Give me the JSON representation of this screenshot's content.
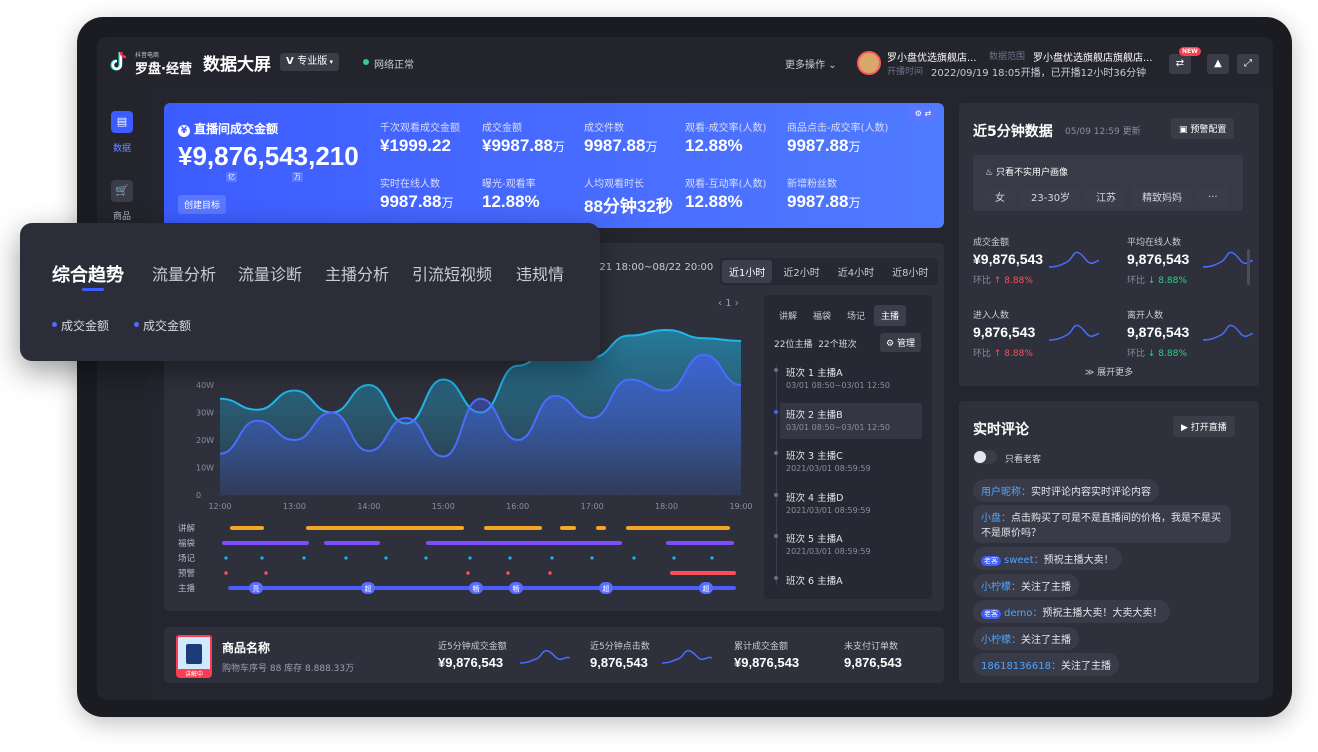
{
  "brand": {
    "small": "抖音电商",
    "name": "罗盘·经营"
  },
  "header": {
    "title": "数据大屏",
    "edition": "专业版",
    "network": "网络正常",
    "more": "更多操作",
    "shop_name": "罗小盘优选旗舰店...",
    "range_label": "数据范围",
    "range_value": "罗小盘优选旗舰店旗舰店...",
    "time_label": "开播时间",
    "time_value": "2022/09/19 18:05开播，已开播12小时36分钟",
    "new_badge": "NEW"
  },
  "sidebar": {
    "items": [
      {
        "label": "数据",
        "icon": "data-icon",
        "active": true
      },
      {
        "label": "商品",
        "icon": "cart-icon",
        "active": false
      }
    ]
  },
  "gmv": {
    "title": "直播间成交金额",
    "value": "¥9,876,543,210",
    "unit1": "亿",
    "unit2": "万",
    "create_goal": "创建目标"
  },
  "metrics": [
    {
      "label": "千次观看成交金额",
      "value": "¥1999.22",
      "unit": ""
    },
    {
      "label": "成交金额",
      "value": "¥9987.88",
      "unit": "万"
    },
    {
      "label": "成交件数",
      "value": "9987.88",
      "unit": "万"
    },
    {
      "label": "观看-成交率(人数)",
      "value": "12.88%",
      "unit": ""
    },
    {
      "label": "商品点击-成交率(人数)",
      "value": "9987.88",
      "unit": "万"
    },
    {
      "label": "实时在线人数",
      "value": "9987.88",
      "unit": "万"
    },
    {
      "label": "曝光-观看率",
      "value": "12.88%",
      "unit": ""
    },
    {
      "label": "人均观看时长",
      "value": "88分钟32秒",
      "unit": ""
    },
    {
      "label": "观看-互动率(人数)",
      "value": "12.88%",
      "unit": ""
    },
    {
      "label": "新增粉丝数",
      "value": "9987.88",
      "unit": "万"
    }
  ],
  "trend": {
    "range": "/21 18:00~08/22 20:00",
    "time_tabs": [
      "近1小时",
      "近2小时",
      "近4小时",
      "近8小时"
    ],
    "pager": "1",
    "y_ticks": [
      "40W",
      "30W",
      "20W",
      "10W",
      "0"
    ],
    "x_ticks": [
      "12:00",
      "13:00",
      "14:00",
      "15:00",
      "16:00",
      "17:00",
      "18:00",
      "19:00"
    ],
    "rows": [
      "讲解",
      "福袋",
      "场记",
      "预警",
      "主播"
    ],
    "anchor_marks": [
      "亮",
      "超",
      "畅",
      "畅",
      "超",
      "超"
    ]
  },
  "chart_data": {
    "type": "area",
    "x": [
      "12:00",
      "12:30",
      "13:00",
      "13:30",
      "14:00",
      "14:30",
      "15:00",
      "15:30",
      "16:00",
      "16:30",
      "17:00",
      "17:30",
      "18:00",
      "18:30",
      "19:00"
    ],
    "series": [
      {
        "values": [
          35,
          31,
          38,
          30,
          40,
          26,
          42,
          30,
          47,
          55,
          50,
          58,
          60,
          57,
          56
        ]
      },
      {
        "values": [
          15,
          27,
          20,
          30,
          16,
          28,
          14,
          35,
          20,
          36,
          28,
          42,
          38,
          51,
          40
        ]
      }
    ],
    "ylim": [
      0,
      60
    ],
    "yticks": [
      "40W",
      "30W",
      "20W",
      "10W",
      "0"
    ],
    "xticks": [
      "12:00",
      "13:00",
      "14:00",
      "15:00",
      "16:00",
      "17:00",
      "18:00",
      "19:00"
    ]
  },
  "shifts": {
    "tabs": [
      "讲解",
      "福袋",
      "场记",
      "主播"
    ],
    "summary1": "22位主播",
    "summary2": "22个班次",
    "manage": "管理",
    "items": [
      {
        "name": "班次 1  主播A",
        "time": "03/01 08:50~03/01 12:50"
      },
      {
        "name": "班次 2  主播B",
        "time": "03/01 08:50~03/01 12:50"
      },
      {
        "name": "班次 3  主播C",
        "time": "2021/03/01 08:59:59"
      },
      {
        "name": "班次 4  主播D",
        "time": "2021/03/01 08:59:59"
      },
      {
        "name": "班次 5  主播A",
        "time": "2021/03/01 08:59:59"
      },
      {
        "name": "班次 6  主播A",
        "time": ""
      }
    ]
  },
  "product": {
    "name": "商品名称",
    "meta": "购物车序号 88  库存 8.888.33万",
    "badge": "讲解中",
    "stats": [
      {
        "label": "近5分钟成交金额",
        "value": "¥9,876,543"
      },
      {
        "label": "近5分钟点击数",
        "value": "9,876,543"
      },
      {
        "label": "累计成交金额",
        "value": "¥9,876,543"
      },
      {
        "label": "未支付订单数",
        "value": "9,876,543"
      }
    ]
  },
  "recent": {
    "title": "近5分钟数据",
    "updated": "05/09 12:59 更新",
    "alert_btn": "预警配置",
    "filter_label": "只看不实用户画像",
    "chips": [
      "女",
      "23-30岁",
      "江苏",
      "精致妈妈",
      "..."
    ],
    "items": [
      {
        "label": "成交金额",
        "value": "¥9,876,543",
        "ratio_label": "环比",
        "ratio": "8.88%",
        "dir": "up"
      },
      {
        "label": "平均在线人数",
        "value": "9,876,543",
        "ratio_label": "环比",
        "ratio": "8.88%",
        "dir": "down"
      },
      {
        "label": "进入人数",
        "value": "9,876,543",
        "ratio_label": "环比",
        "ratio": "8.88%",
        "dir": "up"
      },
      {
        "label": "离开人数",
        "value": "9,876,543",
        "ratio_label": "环比",
        "ratio": "8.88%",
        "dir": "down"
      }
    ],
    "expand": "展开更多"
  },
  "comments": {
    "title": "实时评论",
    "open_btn": "打开直播",
    "toggle_label": "只看老客",
    "old_tag": "老客",
    "items": [
      {
        "name": "用户昵称：",
        "text": "实时评论内容实时评论内容",
        "tag": false
      },
      {
        "name": "小盘：",
        "text": "点击购买了可是不是直播间的价格，我是不是买不是原价吗？",
        "tag": false
      },
      {
        "name": "sweet：",
        "text": "预祝主播大卖！",
        "tag": true
      },
      {
        "name": "小柠檬：",
        "text": "关注了主播",
        "tag": false
      },
      {
        "name": "demo：",
        "text": "预祝主播大卖！大卖大卖！",
        "tag": true
      },
      {
        "name": "小柠檬：",
        "text": "关注了主播",
        "tag": false
      },
      {
        "name": "18618136618：",
        "text": "关注了主播",
        "tag": false
      }
    ]
  },
  "overlay": {
    "tabs": [
      "综合趋势",
      "流量分析",
      "流量诊断",
      "主播分析",
      "引流短视频",
      "违规情"
    ],
    "legend": [
      "成交金额",
      "成交金额"
    ]
  },
  "colors": {
    "accent": "#3d5cff",
    "series1": "#1fb6e8",
    "series2": "#4c5cff",
    "up": "#ff4d57",
    "down": "#2ed08b"
  }
}
